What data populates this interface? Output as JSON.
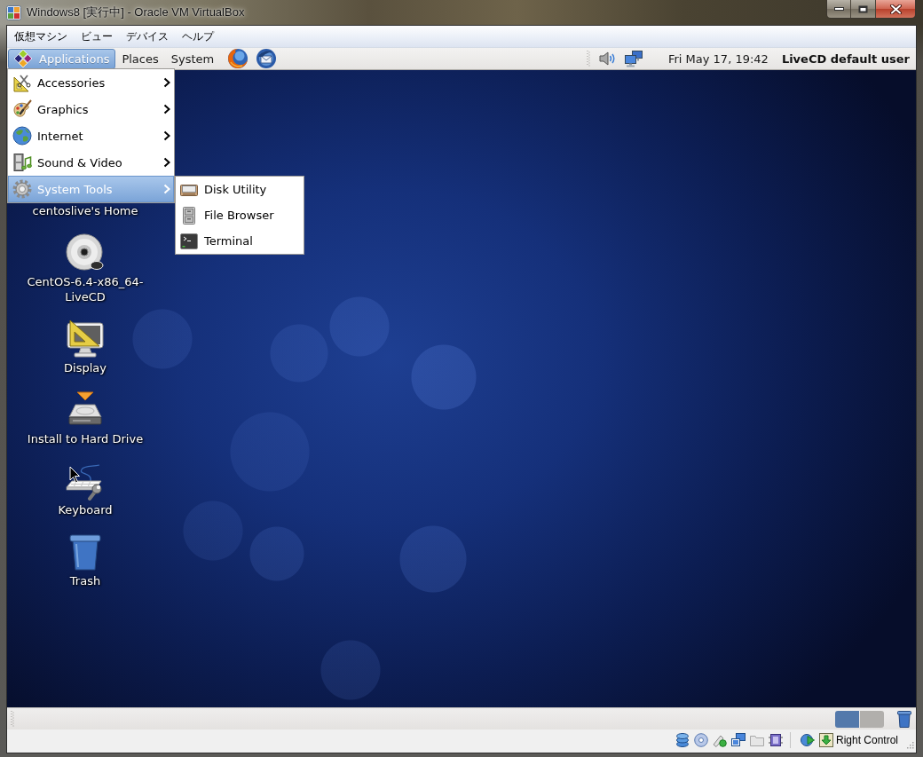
{
  "window": {
    "title": "Windows8 [実行中] - Oracle VM VirtualBox"
  },
  "menu_bar": [
    "仮想マシン",
    "ビュー",
    "デバイス",
    "ヘルプ"
  ],
  "top_panel": {
    "menus": [
      {
        "label": "Applications",
        "selected": true
      },
      {
        "label": "Places",
        "selected": false
      },
      {
        "label": "System",
        "selected": false
      }
    ],
    "clock": "Fri May 17, 19:42",
    "user": "LiveCD default user"
  },
  "applications_menu": {
    "items": [
      {
        "label": "Accessories",
        "selected": false
      },
      {
        "label": "Graphics",
        "selected": false
      },
      {
        "label": "Internet",
        "selected": false
      },
      {
        "label": "Sound & Video",
        "selected": false
      },
      {
        "label": "System Tools",
        "selected": true
      }
    ]
  },
  "system_tools_submenu": {
    "items": [
      {
        "label": "Disk Utility",
        "selected": false
      },
      {
        "label": "File Browser",
        "selected": false
      },
      {
        "label": "Terminal",
        "selected": false
      }
    ]
  },
  "desktop_icons": [
    {
      "label": "centoslive's Home"
    },
    {
      "label": "CentOS-6.4-x86_64-LiveCD"
    },
    {
      "label": "Display"
    },
    {
      "label": "Install to Hard Drive"
    },
    {
      "label": "Keyboard"
    },
    {
      "label": "Trash"
    }
  ],
  "bottom_panel": {
    "workspaces": [
      {
        "selected": true
      },
      {
        "selected": false
      }
    ]
  },
  "status_bar": {
    "host_key": "Right Control"
  }
}
